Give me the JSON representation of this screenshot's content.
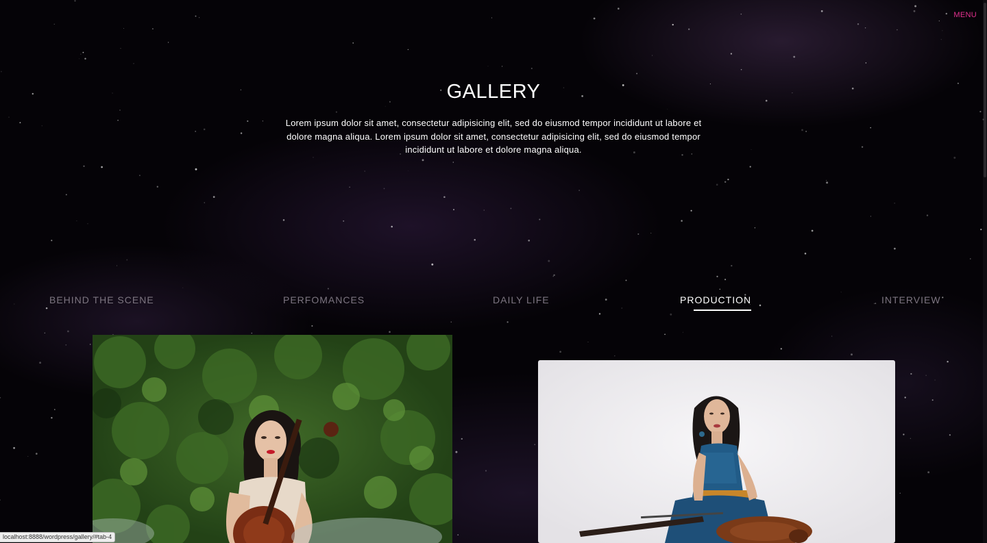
{
  "header": {
    "menu_label": "MENU"
  },
  "page": {
    "title": "GALLERY",
    "intro": "Lorem ipsum dolor sit amet, consectetur adipisicing elit, sed do eiusmod tempor incididunt ut labore et dolore magna aliqua. Lorem ipsum dolor sit amet, consectetur adipisicing elit, sed do eiusmod tempor incididunt ut labore et dolore magna aliqua."
  },
  "tabs": [
    {
      "label": "BEHIND THE SCENE",
      "active": false
    },
    {
      "label": "PERFOMANCES",
      "active": false
    },
    {
      "label": "DAILY LIFE",
      "active": false
    },
    {
      "label": "PRODUCTION",
      "active": true
    },
    {
      "label": "INTERVIEW",
      "active": false
    }
  ],
  "gallery": [
    {
      "subject": "cellist in forest"
    },
    {
      "subject": "cellist in studio"
    }
  ],
  "status_bar": {
    "url": "localhost:8888/wordpress/gallery/#tab-4"
  },
  "colors": {
    "accent": "#e3318f",
    "background": "#050307",
    "tab_inactive": "#7c7580",
    "tab_active": "#ffffff"
  }
}
